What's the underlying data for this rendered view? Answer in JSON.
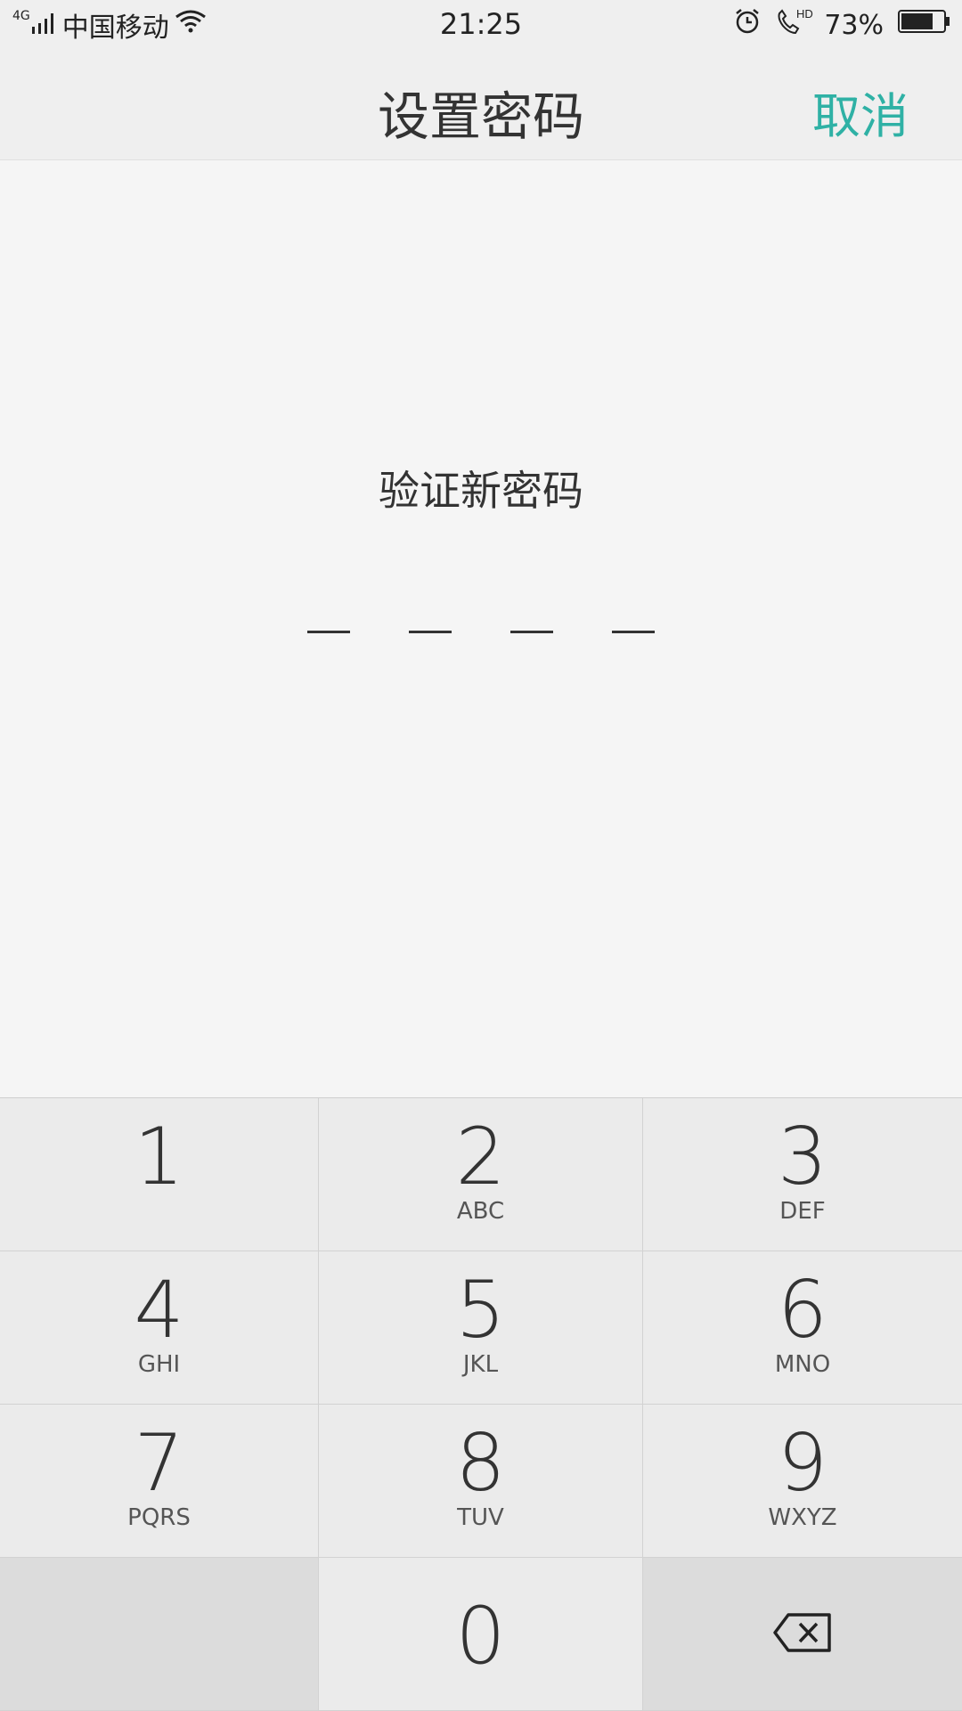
{
  "status_bar": {
    "network": "4G",
    "carrier": "中国移动",
    "time": "21:25",
    "battery": "73%",
    "icons": [
      "signal-icon",
      "wifi-icon",
      "alarm-icon",
      "hd-call-icon",
      "battery-icon"
    ]
  },
  "header": {
    "title": "设置密码",
    "cancel_label": "取消"
  },
  "main": {
    "prompt": "验证新密码",
    "pin_length": 4
  },
  "keypad": {
    "keys": [
      {
        "digit": "1",
        "letters": ""
      },
      {
        "digit": "2",
        "letters": "ABC"
      },
      {
        "digit": "3",
        "letters": "DEF"
      },
      {
        "digit": "4",
        "letters": "GHI"
      },
      {
        "digit": "5",
        "letters": "JKL"
      },
      {
        "digit": "6",
        "letters": "MNO"
      },
      {
        "digit": "7",
        "letters": "PQRS"
      },
      {
        "digit": "8",
        "letters": "TUV"
      },
      {
        "digit": "9",
        "letters": "WXYZ"
      },
      {
        "digit": "0",
        "letters": ""
      }
    ]
  },
  "colors": {
    "accent": "#2fb1a5",
    "text": "#333333",
    "key_bg": "#ebebeb",
    "key_dark_bg": "#dcdcdc"
  }
}
